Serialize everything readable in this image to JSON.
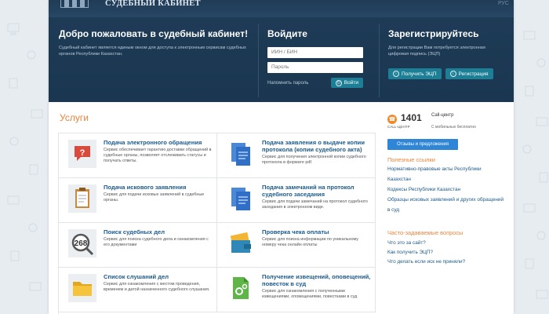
{
  "header": {
    "logo_text": "СУДЕБНЫЙ КАБИНЕТ",
    "lang": "РУС",
    "welcome": {
      "title": "Добро пожаловать в судебный кабинет!",
      "text": "Судебный кабинет является единым окном для доступа к электронным сервисам судебных органов Республики Казахстан."
    },
    "login": {
      "title": "Войдите",
      "iin_placeholder": "ИИН / БИН",
      "password_placeholder": "Пароль",
      "forgot": "Напомнить пароль",
      "submit": "Войти"
    },
    "register": {
      "title": "Зарегистрируйтесь",
      "text": "Для регистрации Вам потребуется электронная цифровая подпись (ЭЦП)",
      "get_eds": "Получить ЭЦП",
      "register": "Регистрация"
    }
  },
  "services": {
    "title": "Услуги",
    "items": [
      {
        "title": "Подача электронного обращения",
        "desc": "Сервис обеспечивает гарантию доставки обращений в судебные органы, позволяет отслеживать статусы и получать ответы.",
        "icon": "alert-speech-icon"
      },
      {
        "title": "Подача заявления о выдаче копии протокола (копии судебного акта)",
        "desc": "Сервис для получения электронной копии судебного протокола в формате pdf.",
        "icon": "documents-icon"
      },
      {
        "title": "Подача искового заявления",
        "desc": "Сервис для подачи исковых заявлений в судебные органы.",
        "icon": "clipboard-icon"
      },
      {
        "title": "Подача замечаний на протокол судебного заседания",
        "desc": "Сервис для подачи замечаний на протокол судебного заседания в электронном виде.",
        "icon": "documents-icon"
      },
      {
        "title": "Поиск судебных дел",
        "desc": "Сервис для поиска судебного дела и ознакомления с его документами",
        "icon": "search-case-icon"
      },
      {
        "title": "Проверка чека оплаты",
        "desc": "Сервис для поиска информации по уникальному номеру чека онлайн оплаты",
        "icon": "wallet-card-icon"
      },
      {
        "title": "Список слушаний дел",
        "desc": "Сервис для ознакомления с местом проведения, временем и датой назначенного судебного слушания.",
        "icon": "folder-icon"
      },
      {
        "title": "Получение извещений, оповещений, повесток в суд",
        "desc": "Сервис для ознакомления с полученными извещениями, оповещениями, повестками в суд",
        "icon": "settings-document-icon"
      }
    ]
  },
  "sidebar": {
    "call_number": "1401",
    "call_center_label": "Call-центр",
    "call_center_sub": "CALL-ЦЕНТР",
    "call_free": "С мобильных бесплатно",
    "feedback": "Отзывы и предложения",
    "links_title": "Полезные ссылки",
    "links": [
      "Нормативно-правовые акты Республики Казахстан",
      "Кодексы Республики Казахстан",
      "Образцы исковых заявлений и других обращений в суд"
    ],
    "faq_title": "Часто-задаваемые вопросы",
    "faq": [
      "Что это за сайт?",
      "Как получить ЭЦП?",
      "Что делать если иск не приняли?"
    ]
  },
  "colors": {
    "header_bg": "#1f3c58",
    "accent_orange": "#e8853a",
    "link_blue": "#1b5a8c",
    "button_teal": "#1c7f95",
    "button_blue": "#2f86d6"
  }
}
